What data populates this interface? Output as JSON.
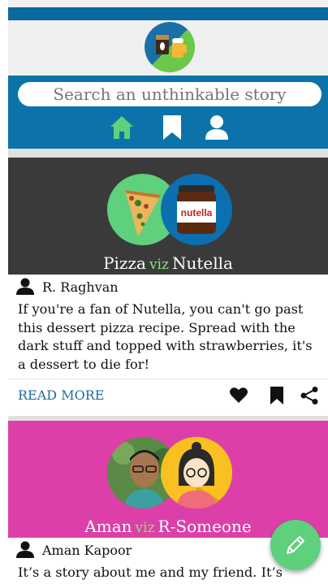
{
  "search": {
    "placeholder": "Search an unthinkable story"
  },
  "nav": {
    "home": "home-icon",
    "bookmarks": "bookmark-icon",
    "profile": "user-icon"
  },
  "colors": {
    "accent": "#0b73a9",
    "nav_active": "#5fd07c",
    "card1_bg": "#3a3a3a",
    "card2_bg": "#dc40a8",
    "viz": "#8be07a",
    "link": "#1e6fa0",
    "fab": "#5fd07c"
  },
  "stories": [
    {
      "left": "Pizza",
      "viz": "viz",
      "right": "Nutella",
      "author": "R. Raghvan",
      "excerpt": "If you're a fan of Nutella, you can't go past this dessert pizza recipe. Spread with the dark stuff and topped with strawberries, it's a dessert to die for!",
      "read_more": "READ MORE",
      "actions": [
        "heart-icon",
        "bookmark-icon",
        "share-icon"
      ]
    },
    {
      "left": "Aman",
      "viz": "viz",
      "right": "R-Someone",
      "author": "Aman Kapoor",
      "excerpt": "It’s a story about me and my friend. It’s story"
    }
  ],
  "fab": {
    "icon": "pencil-icon"
  }
}
